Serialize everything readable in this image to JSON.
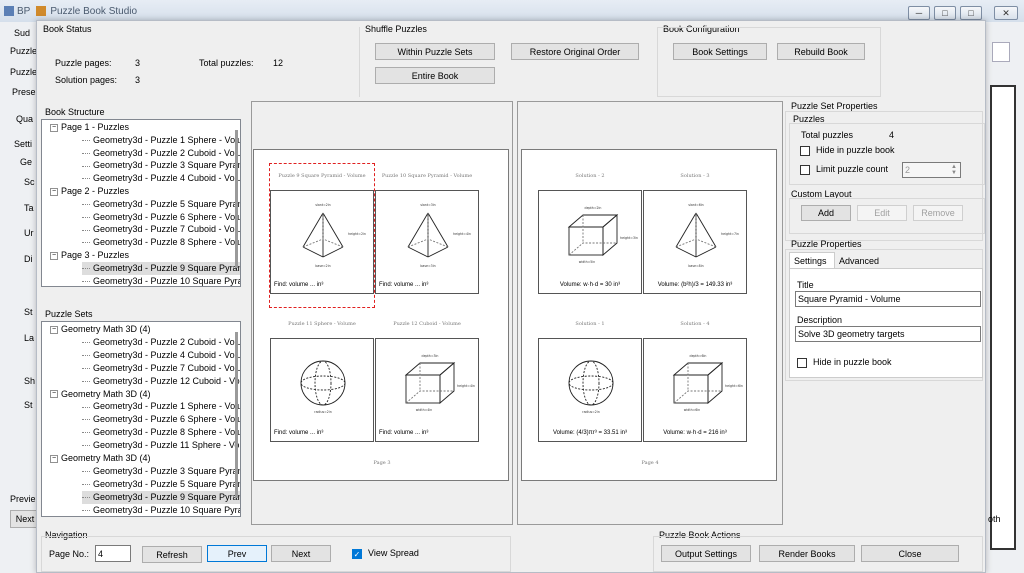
{
  "background": {
    "app_prefix": "BP",
    "window_title": "Puzzle Book Studio",
    "side_fragments": [
      "Sud",
      "Puzzle",
      "Puzzle",
      "Prese",
      "Qua",
      "Setti",
      "Ge",
      "Sc",
      "Ta",
      "Ur",
      "Di",
      "St",
      "La",
      "Sh",
      "St"
    ],
    "preview_label": "Previe",
    "next_label": "Next",
    "oth_label": "oth"
  },
  "window_controls": [
    "─",
    "□",
    "✕"
  ],
  "book_status": {
    "title": "Book Status",
    "puzzle_pages_label": "Puzzle pages:",
    "puzzle_pages": "3",
    "solution_pages_label": "Solution pages:",
    "solution_pages": "3",
    "total_puzzles_label": "Total puzzles:",
    "total_puzzles": "12"
  },
  "shuffle": {
    "title": "Shuffle Puzzles",
    "within_sets": "Within Puzzle Sets",
    "restore": "Restore Original Order",
    "entire": "Entire Book"
  },
  "config": {
    "title": "Book Configuration",
    "settings": "Book Settings",
    "rebuild": "Rebuild Book"
  },
  "book_structure": {
    "title": "Book Structure",
    "items": [
      {
        "text": "Page 1 - Puzzles",
        "level": 1
      },
      {
        "text": "Geometry3d - Puzzle 1 Sphere - Volum",
        "level": 2
      },
      {
        "text": "Geometry3d - Puzzle 2 Cuboid - Volum",
        "level": 2
      },
      {
        "text": "Geometry3d - Puzzle 3 Square Pyrami",
        "level": 2
      },
      {
        "text": "Geometry3d - Puzzle 4 Cuboid - Volum",
        "level": 2
      },
      {
        "text": "Page 2 - Puzzles",
        "level": 1
      },
      {
        "text": "Geometry3d - Puzzle 5 Square Pyrami",
        "level": 2
      },
      {
        "text": "Geometry3d - Puzzle 6 Sphere - Volum",
        "level": 2
      },
      {
        "text": "Geometry3d - Puzzle 7 Cuboid - Volum",
        "level": 2
      },
      {
        "text": "Geometry3d - Puzzle 8 Sphere - Volum",
        "level": 2
      },
      {
        "text": "Page 3 - Puzzles",
        "level": 1
      },
      {
        "text": "Geometry3d - Puzzle 9 Square Pyrami",
        "level": 2,
        "selected": true
      },
      {
        "text": "Geometry3d - Puzzle 10 Square Pyran",
        "level": 2
      }
    ]
  },
  "puzzle_sets": {
    "title": "Puzzle Sets",
    "items": [
      {
        "text": "Geometry Math 3D (4)",
        "level": 1
      },
      {
        "text": "Geometry3d - Puzzle 2 Cuboid - Volume",
        "level": 2
      },
      {
        "text": "Geometry3d - Puzzle 4 Cuboid - Volume",
        "level": 2
      },
      {
        "text": "Geometry3d - Puzzle 7 Cuboid - Volume",
        "level": 2
      },
      {
        "text": "Geometry3d - Puzzle 12 Cuboid - Volume",
        "level": 2
      },
      {
        "text": "Geometry Math 3D (4)",
        "level": 1
      },
      {
        "text": "Geometry3d - Puzzle 1 Sphere - Volume",
        "level": 2
      },
      {
        "text": "Geometry3d - Puzzle 6 Sphere - Volume",
        "level": 2
      },
      {
        "text": "Geometry3d - Puzzle 8 Sphere - Volume",
        "level": 2
      },
      {
        "text": "Geometry3d - Puzzle 11 Sphere - Volume",
        "level": 2
      },
      {
        "text": "Geometry Math 3D (4)",
        "level": 1
      },
      {
        "text": "Geometry3d - Puzzle 3 Square Pyramid - \\",
        "level": 2
      },
      {
        "text": "Geometry3d - Puzzle 5 Square Pyramid - \\",
        "level": 2
      },
      {
        "text": "Geometry3d - Puzzle 9 Square Pyramid - \\",
        "level": 2,
        "selected": true
      },
      {
        "text": "Geometry3d - Puzzle 10 Square Pyramid -",
        "level": 2
      }
    ]
  },
  "preview": {
    "left": {
      "page_label": "Page 3",
      "cards": [
        {
          "header": "Puzzle 9 Square Pyramid - Volume",
          "shape": "pyramid",
          "answer": "Find: volume          ... in³",
          "selected": true,
          "dims": [
            "slant=2in",
            "height=2in",
            "base=2in"
          ]
        },
        {
          "header": "Puzzle 10 Square Pyramid - Volume",
          "shape": "pyramid",
          "answer": "Find: volume          ... in³",
          "dims": [
            "slant=3in",
            "height=4in",
            "base=3in"
          ]
        },
        {
          "header": "Puzzle 11 Sphere - Volume",
          "shape": "sphere",
          "answer": "Find: volume          ... in³",
          "dims": [
            "radius=2in"
          ]
        },
        {
          "header": "Puzzle 12 Cuboid - Volume",
          "shape": "cuboid",
          "answer": "Find: volume          ... in³",
          "dims": [
            "depth=3in",
            "height=4in",
            "width=4in"
          ]
        }
      ]
    },
    "right": {
      "page_label": "Page 4",
      "cards": [
        {
          "header": "Solution - 2",
          "shape": "cuboid",
          "answer": "Volume: w·h·d = 30 in³",
          "dims": [
            "depth=2in",
            "height=3in",
            "width=5in"
          ]
        },
        {
          "header": "Solution - 3",
          "shape": "pyramid",
          "answer": "Volume: (b²h)/3 = 149.33 in³",
          "dims": [
            "slant=6in",
            "height=7in",
            "base=8in"
          ]
        },
        {
          "header": "Solution - 1",
          "shape": "sphere",
          "answer": "Volume: (4/3)πr³ = 33.51 in³",
          "dims": [
            "radius=2in"
          ]
        },
        {
          "header": "Solution - 4",
          "shape": "cuboid",
          "answer": "Volume: w·h·d = 216 in³",
          "dims": [
            "depth=6in",
            "height=6in",
            "width=6in"
          ]
        }
      ]
    }
  },
  "set_props": {
    "title": "Puzzle Set Properties",
    "puzzles_group": "Puzzles",
    "total_label": "Total puzzles",
    "total": "4",
    "hide": "Hide in puzzle book",
    "limit": "Limit puzzle count",
    "limit_value": "2",
    "custom_title": "Custom Layout",
    "add": "Add",
    "edit": "Edit",
    "remove": "Remove"
  },
  "puzzle_props": {
    "title": "Puzzle Properties",
    "tab_settings": "Settings",
    "tab_advanced": "Advanced",
    "title_label": "Title",
    "title_value": "Square Pyramid - Volume",
    "desc_label": "Description",
    "desc_value": "Solve 3D geometry targets",
    "hide": "Hide in puzzle book"
  },
  "navigation": {
    "title": "Navigation",
    "page_label": "Page No.:",
    "page_value": "4",
    "refresh": "Refresh",
    "prev": "Prev",
    "next": "Next",
    "view_spread": "View Spread",
    "view_spread_checked": true
  },
  "actions": {
    "title": "Puzzle Book Actions",
    "output": "Output Settings",
    "render": "Render Books",
    "close": "Close"
  }
}
